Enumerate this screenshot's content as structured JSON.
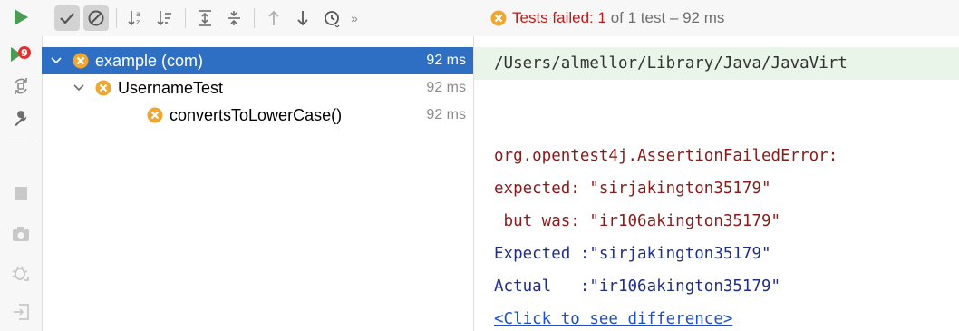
{
  "toolbar": {
    "status_title": "Tests failed:",
    "status_count": "1",
    "status_rest": "of 1 test – 92 ms"
  },
  "tree": {
    "items": [
      {
        "label": "example (com)",
        "time": "92 ms"
      },
      {
        "label": "UsernameTest",
        "time": "92 ms"
      },
      {
        "label": "convertsToLowerCase()",
        "time": "92 ms"
      }
    ]
  },
  "console": {
    "path": "/Users/almellor/Library/Java/JavaVirt",
    "line1": "org.opentest4j.AssertionFailedError:",
    "line2": "expected: \"sirjakington35179\"",
    "line3": " but was: \"ir106akington35179\"",
    "line4": "Expected :\"sirjakington35179\"",
    "line5": "Actual   :\"ir106akington35179\"",
    "link": "<Click to see difference>"
  },
  "colors": {
    "selection": "#2e6fc4",
    "error_red": "#c21a1a",
    "fail_badge": "#f0a732",
    "run_green": "#499c54"
  },
  "icons": [
    "run-icon",
    "rerun-failed-icon",
    "toggle-auto-rerun-icon",
    "settings-wrench-icon",
    "stop-icon",
    "screenshot-icon",
    "debug-icon",
    "export-icon",
    "show-passed-check-icon",
    "show-ignored-icon",
    "sort-alpha-icon",
    "sort-duration-icon",
    "expand-all-icon",
    "collapse-all-icon",
    "prev-failed-icon",
    "next-failed-icon",
    "history-icon",
    "more-icon",
    "failed-icon"
  ]
}
